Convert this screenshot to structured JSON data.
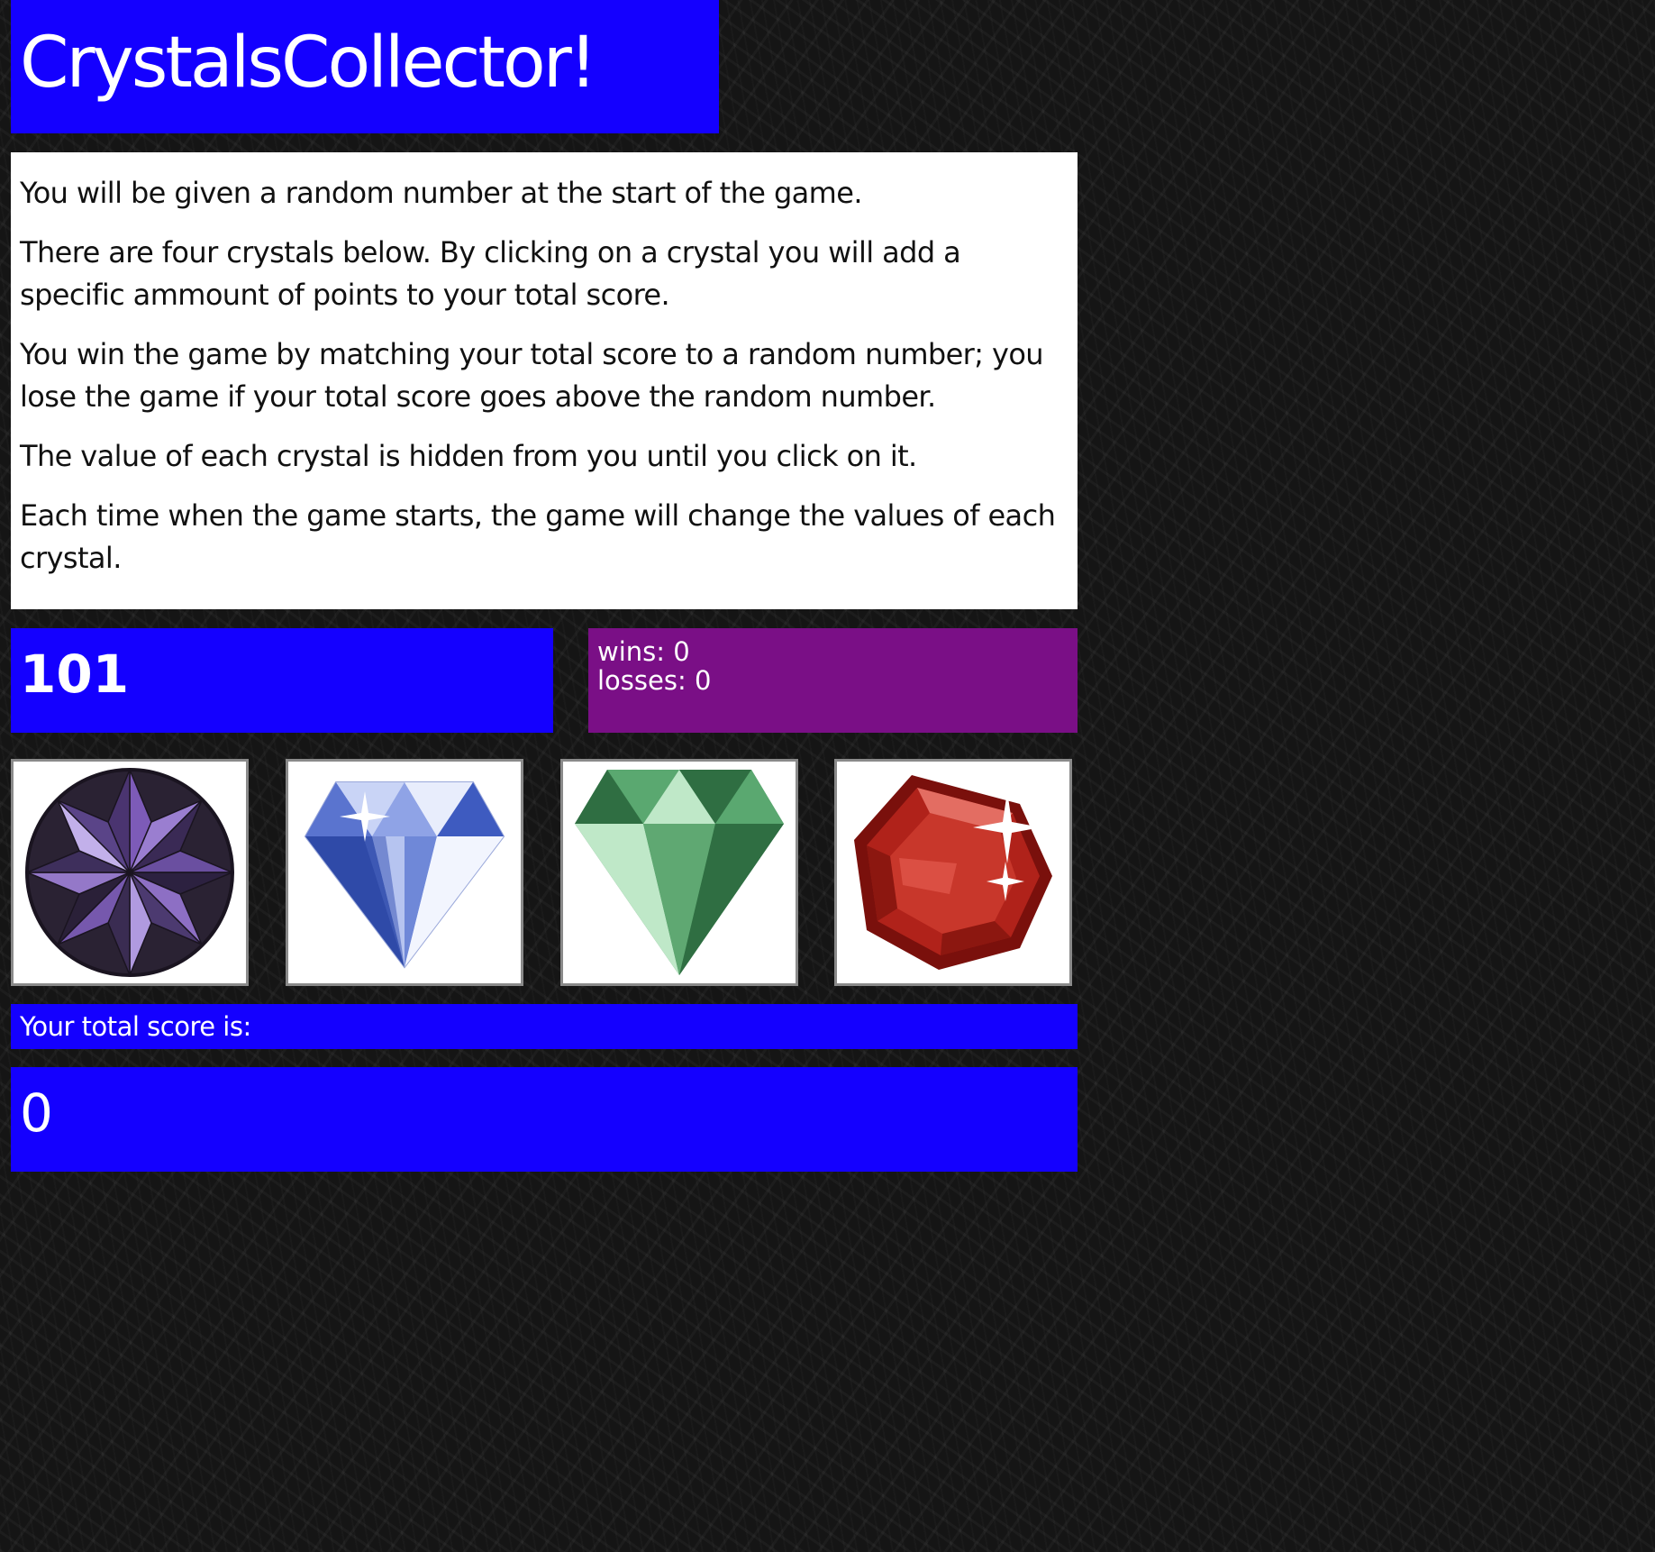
{
  "header": {
    "title": "CrystalsCollector!"
  },
  "instructions": [
    "You will be given a random number at the start of the game.",
    "There are four crystals below. By clicking on a crystal you will add a specific ammount of points to your total score.",
    "You win the game by matching your total score to a random number; you lose the game if your total score goes above the random number.",
    "The value of each crystal is hidden from you until you click on it.",
    "Each time when the game starts, the game will change the values of each crystal."
  ],
  "target": {
    "random_number": "101"
  },
  "record": {
    "wins_label": "wins: 0",
    "losses_label": "losses: 0"
  },
  "crystals": [
    {
      "icon": "purple-round-gem-icon",
      "color": "#6a4fa0"
    },
    {
      "icon": "blue-diamond-icon",
      "color": "#4a63c8"
    },
    {
      "icon": "green-emerald-icon",
      "color": "#3f8a55"
    },
    {
      "icon": "red-ruby-icon",
      "color": "#b0221a"
    }
  ],
  "score": {
    "label": "Your total score is:",
    "value": "0"
  },
  "colors": {
    "accent_blue": "#1400ff",
    "record_purple": "#7a0f86",
    "background": "#151515"
  }
}
